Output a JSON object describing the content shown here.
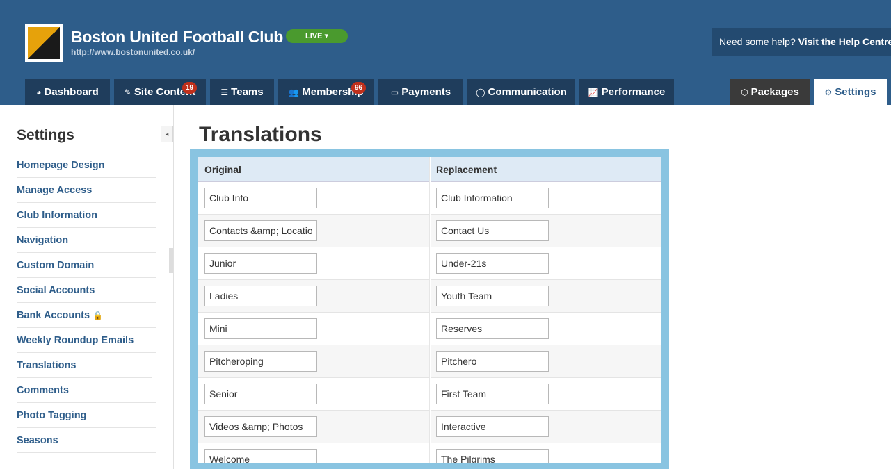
{
  "header": {
    "club_name": "Boston United Football Club",
    "club_url": "http://www.bostonunited.co.uk/",
    "live_label": "LIVE ▾",
    "help_prefix": "Need some help?",
    "help_link": "Visit the Help Centre"
  },
  "nav": {
    "tabs": [
      {
        "label": "Dashboard",
        "icon": "dashboard-icon",
        "glyph": "◕"
      },
      {
        "label": "Site Content",
        "icon": "pencil-icon",
        "glyph": "✎",
        "badge": "19"
      },
      {
        "label": "Teams",
        "icon": "list-icon",
        "glyph": "☰"
      },
      {
        "label": "Membership",
        "icon": "users-icon",
        "glyph": "👥",
        "badge": "96"
      },
      {
        "label": "Payments",
        "icon": "card-icon",
        "glyph": "▭"
      },
      {
        "label": "Communication",
        "icon": "speech-bubble-icon",
        "glyph": "◯"
      },
      {
        "label": "Performance",
        "icon": "chart-icon",
        "glyph": "📈"
      }
    ],
    "packages": {
      "label": "Packages",
      "icon": "cube-icon",
      "glyph": "⬡"
    },
    "settings": {
      "label": "Settings",
      "icon": "gear-icon",
      "glyph": "⚙"
    }
  },
  "sidebar": {
    "title": "Settings",
    "collapse_glyph": "◂",
    "items": [
      {
        "label": "Homepage Design"
      },
      {
        "label": "Manage Access"
      },
      {
        "label": "Club Information"
      },
      {
        "label": "Navigation"
      },
      {
        "label": "Custom Domain"
      },
      {
        "label": "Social Accounts"
      },
      {
        "label": "Bank Accounts",
        "icon": "lock-icon"
      },
      {
        "label": "Weekly Roundup Emails"
      },
      {
        "label": "Translations",
        "active": true
      },
      {
        "label": "Comments"
      },
      {
        "label": "Photo Tagging"
      },
      {
        "label": "Seasons"
      }
    ]
  },
  "main": {
    "title": "Translations",
    "columns": [
      "Original",
      "Replacement"
    ],
    "rows": [
      {
        "original": "Club Info",
        "replacement": "Club Information"
      },
      {
        "original": "Contacts &amp; Locatio",
        "replacement": "Contact Us"
      },
      {
        "original": "Junior",
        "replacement": "Under-21s"
      },
      {
        "original": "Ladies",
        "replacement": "Youth Team"
      },
      {
        "original": "Mini",
        "replacement": "Reserves"
      },
      {
        "original": "Pitcheroping",
        "replacement": "Pitchero"
      },
      {
        "original": "Senior",
        "replacement": "First Team"
      },
      {
        "original": "Videos &amp; Photos",
        "replacement": "Interactive"
      },
      {
        "original": "Welcome",
        "replacement": "The Pilgrims"
      }
    ]
  },
  "colors": {
    "header_bg": "#2e5d8a",
    "tab_bg": "#1f3d5c",
    "live_green": "#4a9a2e",
    "badge_red": "#c0301c",
    "panel_blue": "#89c4e1",
    "link_blue": "#2e5d8a"
  }
}
